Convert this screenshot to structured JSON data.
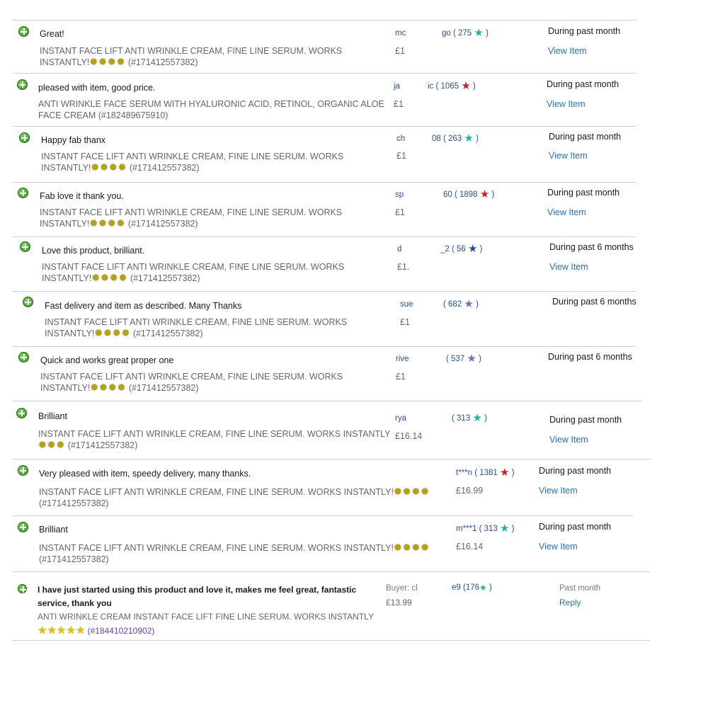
{
  "colors": {
    "teal_star": "#1bb3a4",
    "red_star": "#c61e26",
    "blue_star": "#2b3eae",
    "purple_star": "#8e5cc2",
    "link": "#2a6fb8",
    "positive": "#2f8f1c"
  },
  "icons": {
    "positive": "green-plus-icon",
    "rating_star": "star-icon",
    "badge": "sunburst-icon"
  },
  "rows": [
    {
      "comment": "Great!",
      "item": "INSTANT FACE LIFT ANTI WRINKLE CREAM, FINE LINE SERUM. WORKS",
      "item2": "INSTANTLY!",
      "id": "(#171412557382)",
      "user_a": "mc",
      "user_b": "go ( 275",
      "price": "£1",
      "when": "During past month",
      "link": "View Item"
    },
    {
      "comment": "pleased with item, good price.",
      "item": "ANTI WRINKLE FACE SERUM WITH HYALURONIC ACID, RETINOL, ORGANIC ALOE",
      "item2": "FACE CREAM (#182489675910)",
      "id": "",
      "user_a": "ja",
      "user_b": "ic ( 1065",
      "price": "£1",
      "when": "During past month",
      "link": "View Item"
    },
    {
      "comment": "Happy fab thanx",
      "item": "INSTANT FACE LIFT ANTI WRINKLE CREAM, FINE LINE SERUM. WORKS",
      "item2": "INSTANTLY!",
      "id": "(#171412557382)",
      "user_a": "ch",
      "user_b": "08 ( 263",
      "price": "£1",
      "when": "During past month",
      "link": "View Item"
    },
    {
      "comment": "Fab love it thank you.",
      "item": "INSTANT FACE LIFT ANTI WRINKLE CREAM, FINE LINE SERUM. WORKS",
      "item2": "INSTANTLY!",
      "id": "(#171412557382)",
      "user_a": "sp",
      "user_b": "60 ( 1898",
      "price": "£1",
      "when": "During past month",
      "link": "View Item"
    },
    {
      "comment": "Love this product, brilliant.",
      "item": "INSTANT FACE LIFT ANTI WRINKLE CREAM, FINE LINE SERUM. WORKS",
      "item2": "INSTANTLY!",
      "id": "(#171412557382)",
      "user_a": "d",
      "user_b": "_2 ( 56",
      "price": "£1.",
      "when": "During past 6 months",
      "link": "View Item"
    },
    {
      "comment": "Fast delivery and item as described. Many Thanks",
      "item": "INSTANT FACE LIFT ANTI WRINKLE CREAM, FINE LINE SERUM. WORKS",
      "item2": "INSTANTLY!",
      "id": "(#171412557382)",
      "user_a": "sue",
      "user_b": "( 682",
      "price": "£1",
      "when": "During past 6 months",
      "link": ""
    },
    {
      "comment": "Quick and works great proper one",
      "item": "INSTANT FACE LIFT ANTI WRINKLE CREAM, FINE LINE SERUM. WORKS",
      "item2": "INSTANTLY!",
      "id": "(#171412557382)",
      "user_a": "rive",
      "user_b": "( 537",
      "price": "£1",
      "when": "During past 6 months",
      "link": ""
    },
    {
      "comment": "Brilliant",
      "item": "INSTANT FACE LIFT ANTI WRINKLE CREAM, FINE LINE SERUM. WORKS INSTANTLY",
      "item2": "",
      "id": "(#171412557382)",
      "user_a": "rya",
      "user_b": "( 313",
      "price": "£16.14",
      "when": "During past month",
      "link": "View Item"
    },
    {
      "comment": "Very pleased with item, speedy delivery, many thanks.",
      "item": "INSTANT FACE LIFT ANTI WRINKLE CREAM, FINE LINE SERUM. WORKS INSTANTLY!",
      "item2": "",
      "id": "(#171412557382)",
      "user_a": "",
      "user_b": "t***n ( 1381",
      "price": "£16.99",
      "when": "During past month",
      "link": "View Item"
    },
    {
      "comment": "Brilliant",
      "item": "INSTANT FACE LIFT ANTI WRINKLE CREAM, FINE LINE SERUM. WORKS INSTANTLY!",
      "item2": "",
      "id": "(#171412557382)",
      "user_a": "",
      "user_b": "m***1 ( 313",
      "price": "£16.14",
      "when": "During past month",
      "link": "View Item"
    }
  ],
  "last": {
    "comment1": "I have just started using this product and love it, makes me feel great, fantastic",
    "comment2": "service, thank you",
    "item": "ANTI WRINKLE CREAM INSTANT FACE LIFT FINE LINE SERUM. WORKS INSTANTLY",
    "id": "(#184410210902)",
    "user_a": "Buyer: cl",
    "user_b": "e9 (176",
    "close": ")",
    "price": "£13.99",
    "when": "Past month",
    "link": "Reply"
  },
  "close_paren": ")"
}
